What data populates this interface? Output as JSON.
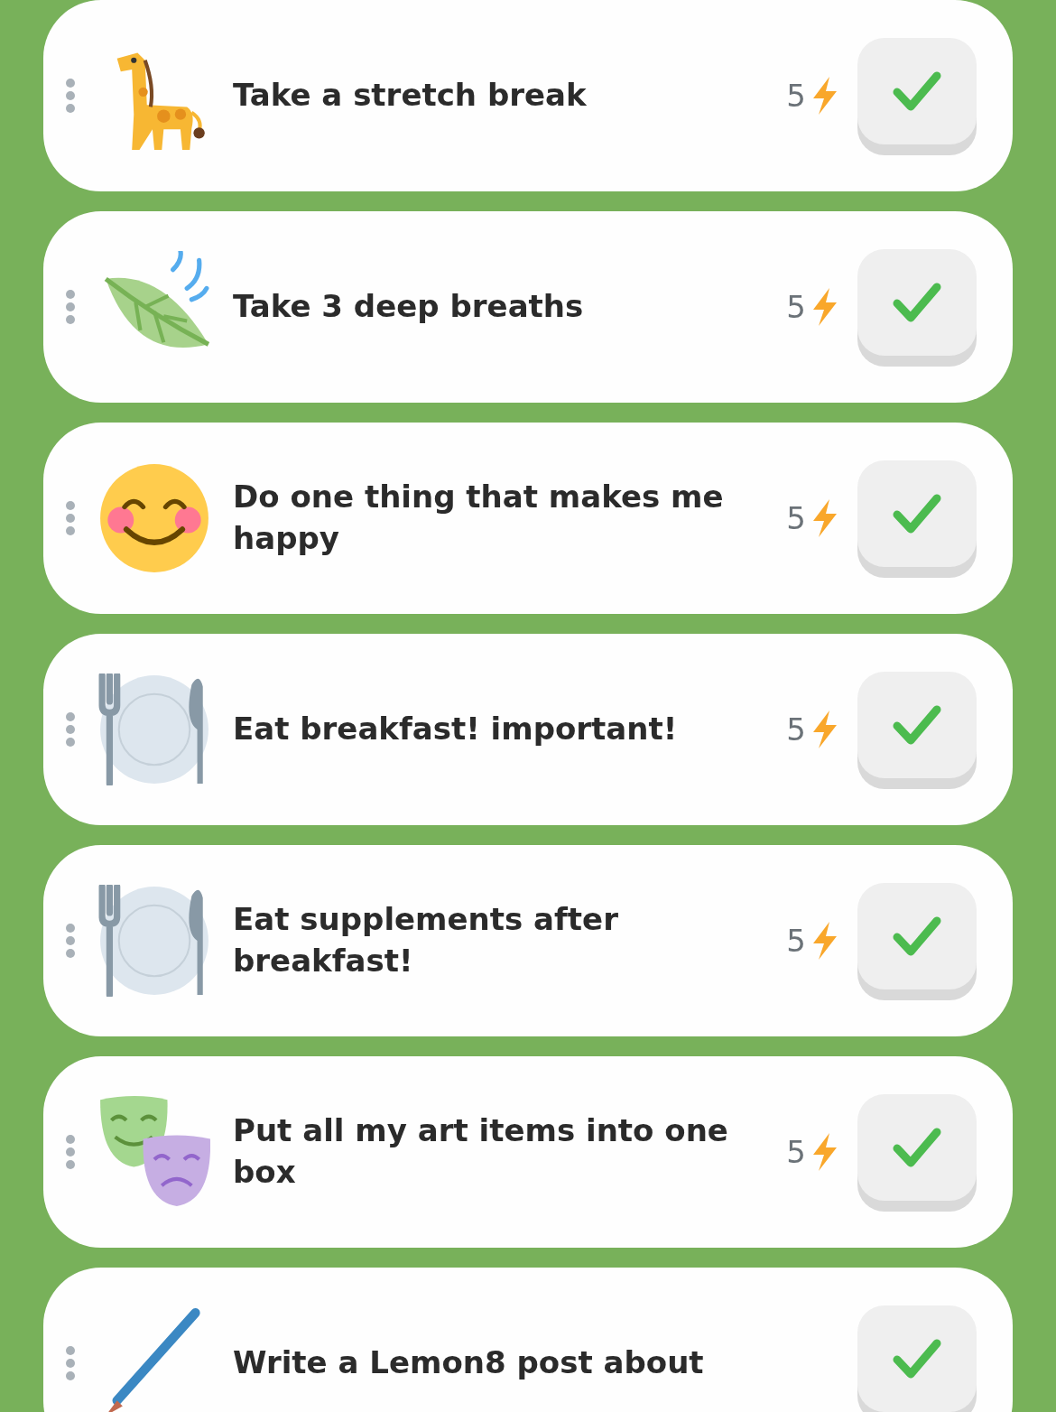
{
  "tasks": [
    {
      "kind": "giraffe",
      "title": "Take a stretch break",
      "points": "5"
    },
    {
      "kind": "leaf",
      "title": "Take 3 deep breaths",
      "points": "5"
    },
    {
      "kind": "smile",
      "title": "Do one thing that makes me happy",
      "points": "5"
    },
    {
      "kind": "plate",
      "title": "Eat breakfast! important!",
      "points": "5"
    },
    {
      "kind": "plate",
      "title": "Eat supplements after breakfast!",
      "points": "5"
    },
    {
      "kind": "masks",
      "title": "Put all my art items into one box",
      "points": "5"
    },
    {
      "kind": "pencil",
      "title": "Write a Lemon8 post about"
    }
  ]
}
